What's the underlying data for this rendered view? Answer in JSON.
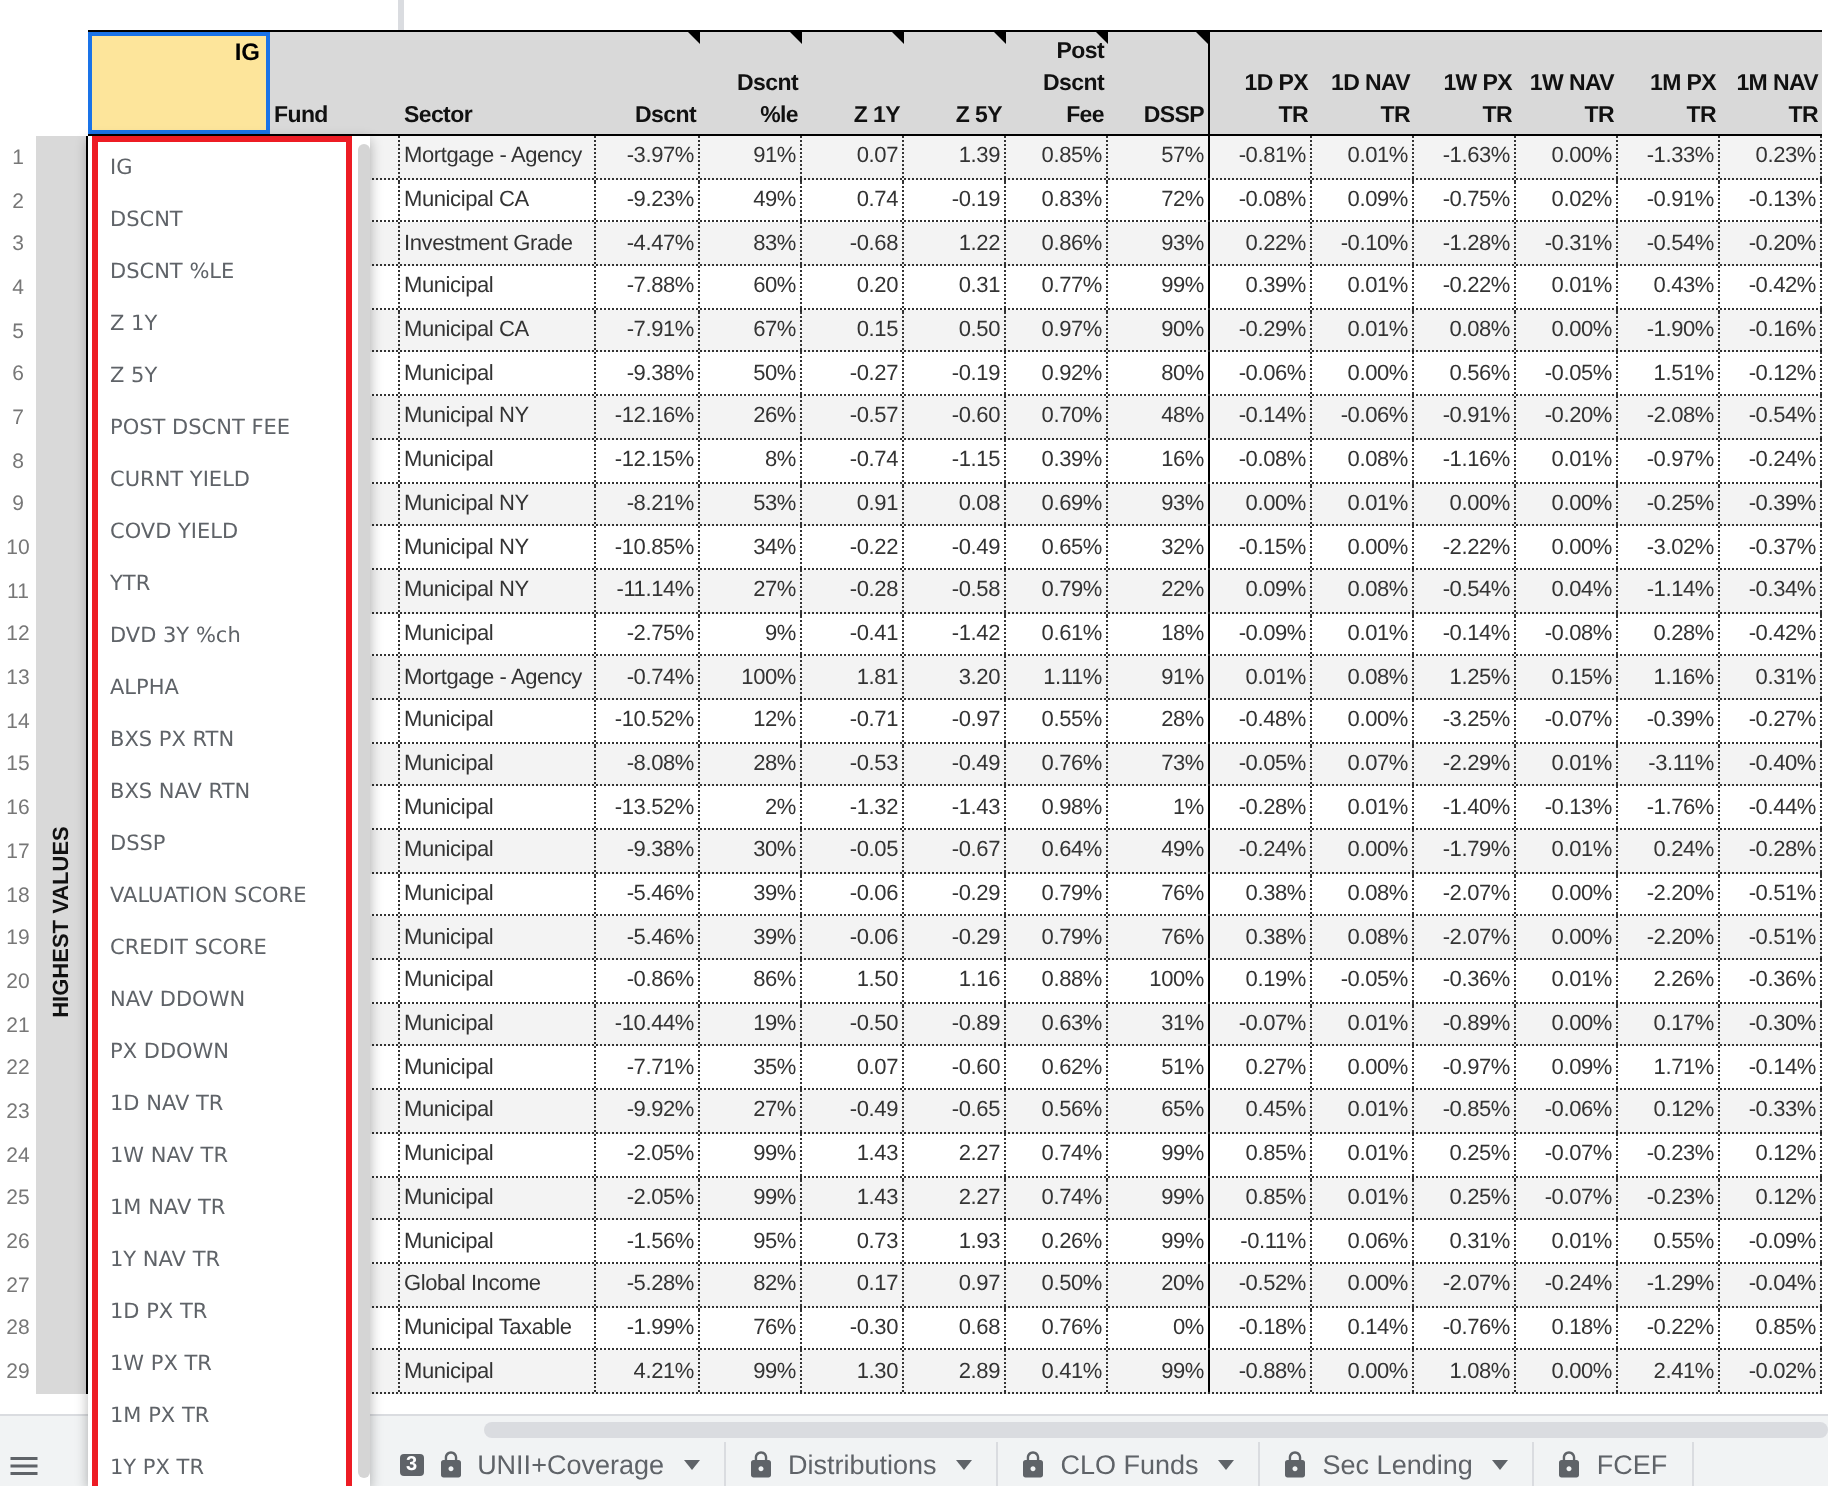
{
  "sheet": {
    "selected_cell": {
      "value": "IG",
      "selected": true
    },
    "columns": [
      {
        "label": "Fund",
        "kind": "text",
        "note": false
      },
      {
        "label": "Sector",
        "kind": "text",
        "note": false
      },
      {
        "label": "Dscnt",
        "kind": "number",
        "note": true
      },
      {
        "label": "Dscnt %le",
        "kind": "number",
        "note": true
      },
      {
        "label": "Z 1Y",
        "kind": "number",
        "note": true
      },
      {
        "label": "Z 5Y",
        "kind": "number",
        "note": true
      },
      {
        "label": "Post Dscnt Fee",
        "kind": "number",
        "note": true
      },
      {
        "label": "DSSP",
        "kind": "number",
        "note": true
      },
      {
        "label": "1D PX TR",
        "kind": "number",
        "note": false
      },
      {
        "label": "1D NAV TR",
        "kind": "number",
        "note": false
      },
      {
        "label": "1W PX TR",
        "kind": "number",
        "note": false
      },
      {
        "label": "1W NAV TR",
        "kind": "number",
        "note": false
      },
      {
        "label": "1M PX TR",
        "kind": "number",
        "note": false
      },
      {
        "label": "1M NAV TR",
        "kind": "number",
        "note": false
      }
    ],
    "group_label": "HIGHEST VALUES",
    "rows": [
      {
        "number": "1",
        "cells": [
          "",
          "Mortgage - Agency",
          "-3.97%",
          "91%",
          "0.07",
          "1.39",
          "0.85%",
          "57%",
          "-0.81%",
          "0.01%",
          "-1.63%",
          "0.00%",
          "-1.33%",
          "0.23%"
        ]
      },
      {
        "number": "2",
        "cells": [
          "",
          "Municipal CA",
          "-9.23%",
          "49%",
          "0.74",
          "-0.19",
          "0.83%",
          "72%",
          "-0.08%",
          "0.09%",
          "-0.75%",
          "0.02%",
          "-0.91%",
          "-0.13%"
        ]
      },
      {
        "number": "3",
        "cells": [
          "",
          "Investment Grade",
          "-4.47%",
          "83%",
          "-0.68",
          "1.22",
          "0.86%",
          "93%",
          "0.22%",
          "-0.10%",
          "-1.28%",
          "-0.31%",
          "-0.54%",
          "-0.20%"
        ]
      },
      {
        "number": "4",
        "cells": [
          "",
          "Municipal",
          "-7.88%",
          "60%",
          "0.20",
          "0.31",
          "0.77%",
          "99%",
          "0.39%",
          "0.01%",
          "-0.22%",
          "0.01%",
          "0.43%",
          "-0.42%"
        ]
      },
      {
        "number": "5",
        "cells": [
          "",
          "Municipal CA",
          "-7.91%",
          "67%",
          "0.15",
          "0.50",
          "0.97%",
          "90%",
          "-0.29%",
          "0.01%",
          "0.08%",
          "0.00%",
          "-1.90%",
          "-0.16%"
        ]
      },
      {
        "number": "6",
        "cells": [
          "",
          "Municipal",
          "-9.38%",
          "50%",
          "-0.27",
          "-0.19",
          "0.92%",
          "80%",
          "-0.06%",
          "0.00%",
          "0.56%",
          "-0.05%",
          "1.51%",
          "-0.12%"
        ]
      },
      {
        "number": "7",
        "cells": [
          "",
          "Municipal NY",
          "-12.16%",
          "26%",
          "-0.57",
          "-0.60",
          "0.70%",
          "48%",
          "-0.14%",
          "-0.06%",
          "-0.91%",
          "-0.20%",
          "-2.08%",
          "-0.54%"
        ]
      },
      {
        "number": "8",
        "cells": [
          "",
          "Municipal",
          "-12.15%",
          "8%",
          "-0.74",
          "-1.15",
          "0.39%",
          "16%",
          "-0.08%",
          "0.08%",
          "-1.16%",
          "0.01%",
          "-0.97%",
          "-0.24%"
        ]
      },
      {
        "number": "9",
        "cells": [
          "",
          "Municipal NY",
          "-8.21%",
          "53%",
          "0.91",
          "0.08",
          "0.69%",
          "93%",
          "0.00%",
          "0.01%",
          "0.00%",
          "0.00%",
          "-0.25%",
          "-0.39%"
        ]
      },
      {
        "number": "10",
        "cells": [
          "",
          "Municipal NY",
          "-10.85%",
          "34%",
          "-0.22",
          "-0.49",
          "0.65%",
          "32%",
          "-0.15%",
          "0.00%",
          "-2.22%",
          "0.00%",
          "-3.02%",
          "-0.37%"
        ]
      },
      {
        "number": "11",
        "cells": [
          "",
          "Municipal NY",
          "-11.14%",
          "27%",
          "-0.28",
          "-0.58",
          "0.79%",
          "22%",
          "0.09%",
          "0.08%",
          "-0.54%",
          "0.04%",
          "-1.14%",
          "-0.34%"
        ]
      },
      {
        "number": "12",
        "cells": [
          "",
          "Municipal",
          "-2.75%",
          "9%",
          "-0.41",
          "-1.42",
          "0.61%",
          "18%",
          "-0.09%",
          "0.01%",
          "-0.14%",
          "-0.08%",
          "0.28%",
          "-0.42%"
        ]
      },
      {
        "number": "13",
        "cells": [
          "",
          "Mortgage - Agency",
          "-0.74%",
          "100%",
          "1.81",
          "3.20",
          "1.11%",
          "91%",
          "0.01%",
          "0.08%",
          "1.25%",
          "0.15%",
          "1.16%",
          "0.31%"
        ]
      },
      {
        "number": "14",
        "cells": [
          "",
          "Municipal",
          "-10.52%",
          "12%",
          "-0.71",
          "-0.97",
          "0.55%",
          "28%",
          "-0.48%",
          "0.00%",
          "-3.25%",
          "-0.07%",
          "-0.39%",
          "-0.27%"
        ]
      },
      {
        "number": "15",
        "cells": [
          "",
          "Municipal",
          "-8.08%",
          "28%",
          "-0.53",
          "-0.49",
          "0.76%",
          "73%",
          "-0.05%",
          "0.07%",
          "-2.29%",
          "0.01%",
          "-3.11%",
          "-0.40%"
        ]
      },
      {
        "number": "16",
        "cells": [
          "",
          "Municipal",
          "-13.52%",
          "2%",
          "-1.32",
          "-1.43",
          "0.98%",
          "1%",
          "-0.28%",
          "0.01%",
          "-1.40%",
          "-0.13%",
          "-1.76%",
          "-0.44%"
        ]
      },
      {
        "number": "17",
        "cells": [
          "",
          "Municipal",
          "-9.38%",
          "30%",
          "-0.05",
          "-0.67",
          "0.64%",
          "49%",
          "-0.24%",
          "0.00%",
          "-1.79%",
          "0.01%",
          "0.24%",
          "-0.28%"
        ]
      },
      {
        "number": "18",
        "cells": [
          "",
          "Municipal",
          "-5.46%",
          "39%",
          "-0.06",
          "-0.29",
          "0.79%",
          "76%",
          "0.38%",
          "0.08%",
          "-2.07%",
          "0.00%",
          "-2.20%",
          "-0.51%"
        ]
      },
      {
        "number": "19",
        "cells": [
          "",
          "Municipal",
          "-5.46%",
          "39%",
          "-0.06",
          "-0.29",
          "0.79%",
          "76%",
          "0.38%",
          "0.08%",
          "-2.07%",
          "0.00%",
          "-2.20%",
          "-0.51%"
        ]
      },
      {
        "number": "20",
        "cells": [
          "",
          "Municipal",
          "-0.86%",
          "86%",
          "1.50",
          "1.16",
          "0.88%",
          "100%",
          "0.19%",
          "-0.05%",
          "-0.36%",
          "0.01%",
          "2.26%",
          "-0.36%"
        ]
      },
      {
        "number": "21",
        "cells": [
          "",
          "Municipal",
          "-10.44%",
          "19%",
          "-0.50",
          "-0.89",
          "0.63%",
          "31%",
          "-0.07%",
          "0.01%",
          "-0.89%",
          "0.00%",
          "0.17%",
          "-0.30%"
        ]
      },
      {
        "number": "22",
        "cells": [
          "",
          "Municipal",
          "-7.71%",
          "35%",
          "0.07",
          "-0.60",
          "0.62%",
          "51%",
          "0.27%",
          "0.00%",
          "-0.97%",
          "0.09%",
          "1.71%",
          "-0.14%"
        ]
      },
      {
        "number": "23",
        "cells": [
          "",
          "Municipal",
          "-9.92%",
          "27%",
          "-0.49",
          "-0.65",
          "0.56%",
          "65%",
          "0.45%",
          "0.01%",
          "-0.85%",
          "-0.06%",
          "0.12%",
          "-0.33%"
        ]
      },
      {
        "number": "24",
        "cells": [
          "",
          "Municipal",
          "-2.05%",
          "99%",
          "1.43",
          "2.27",
          "0.74%",
          "99%",
          "0.85%",
          "0.01%",
          "0.25%",
          "-0.07%",
          "-0.23%",
          "0.12%"
        ]
      },
      {
        "number": "25",
        "cells": [
          "",
          "Municipal",
          "-2.05%",
          "99%",
          "1.43",
          "2.27",
          "0.74%",
          "99%",
          "0.85%",
          "0.01%",
          "0.25%",
          "-0.07%",
          "-0.23%",
          "0.12%"
        ]
      },
      {
        "number": "26",
        "cells": [
          "",
          "Municipal",
          "-1.56%",
          "95%",
          "0.73",
          "1.93",
          "0.26%",
          "99%",
          "-0.11%",
          "0.06%",
          "0.31%",
          "0.01%",
          "0.55%",
          "-0.09%"
        ]
      },
      {
        "number": "27",
        "cells": [
          "",
          "Global Income",
          "-5.28%",
          "82%",
          "0.17",
          "0.97",
          "0.50%",
          "20%",
          "-0.52%",
          "0.00%",
          "-2.07%",
          "-0.24%",
          "-1.29%",
          "-0.04%"
        ]
      },
      {
        "number": "28",
        "cells": [
          "",
          "Municipal Taxable",
          "-1.99%",
          "76%",
          "-0.30",
          "0.68",
          "0.76%",
          "0%",
          "-0.18%",
          "0.14%",
          "-0.76%",
          "0.18%",
          "-0.22%",
          "0.85%"
        ]
      },
      {
        "number": "29",
        "cells": [
          "",
          "Municipal",
          "4.21%",
          "99%",
          "1.30",
          "2.89",
          "0.41%",
          "99%",
          "-0.88%",
          "0.00%",
          "1.08%",
          "0.00%",
          "2.41%",
          "-0.02%"
        ]
      }
    ]
  },
  "dropdown": {
    "items": [
      "IG",
      "DSCNT",
      "DSCNT %LE",
      "Z 1Y",
      "Z 5Y",
      "POST DSCNT FEE",
      "CURNT YIELD",
      "COVD YIELD",
      "YTR",
      "DVD 3Y %ch",
      "ALPHA",
      "BXS PX RTN",
      "BXS NAV RTN",
      "DSSP",
      "VALUATION SCORE",
      "CREDIT SCORE",
      "NAV DDOWN",
      "PX DDOWN",
      "1D NAV TR",
      "1W NAV TR",
      "1M NAV TR",
      "1Y NAV TR",
      "1D PX TR",
      "1W PX TR",
      "1M PX TR",
      "1Y PX TR"
    ]
  },
  "sheet_tabs": [
    {
      "label": "UNII+Coverage",
      "badge": "3",
      "locked": true,
      "menu": true
    },
    {
      "label": "Distributions",
      "locked": true,
      "menu": true
    },
    {
      "label": "CLO Funds",
      "locked": true,
      "menu": true
    },
    {
      "label": "Sec Lending",
      "locked": true,
      "menu": true
    },
    {
      "label": "FCEF",
      "locked": true,
      "menu": false
    }
  ]
}
